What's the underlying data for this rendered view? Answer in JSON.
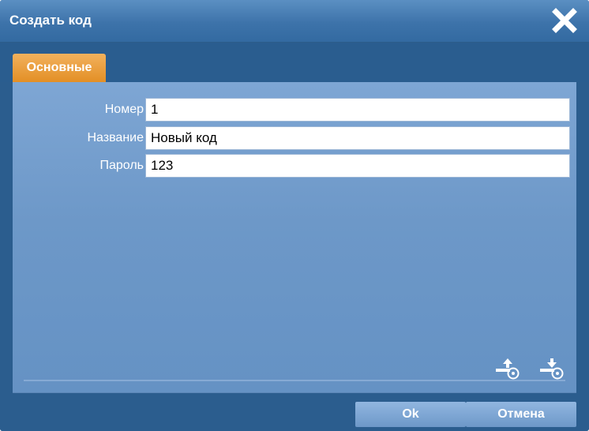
{
  "dialog": {
    "title": "Создать код",
    "close_icon": "close-icon"
  },
  "tabs": [
    {
      "label": "Основные",
      "active": true
    }
  ],
  "form": {
    "number": {
      "label": "Номер",
      "value": "1"
    },
    "name": {
      "label": "Название",
      "value": "Новый код"
    },
    "password": {
      "label": "Пароль",
      "value": "123"
    }
  },
  "panel_icons": {
    "upload": "upload-key-icon",
    "download": "download-key-icon"
  },
  "buttons": {
    "ok": "Ok",
    "cancel": "Отмена"
  },
  "colors": {
    "accent_tab": "#e38f25",
    "dialog_blue": "#2b5d8e"
  }
}
